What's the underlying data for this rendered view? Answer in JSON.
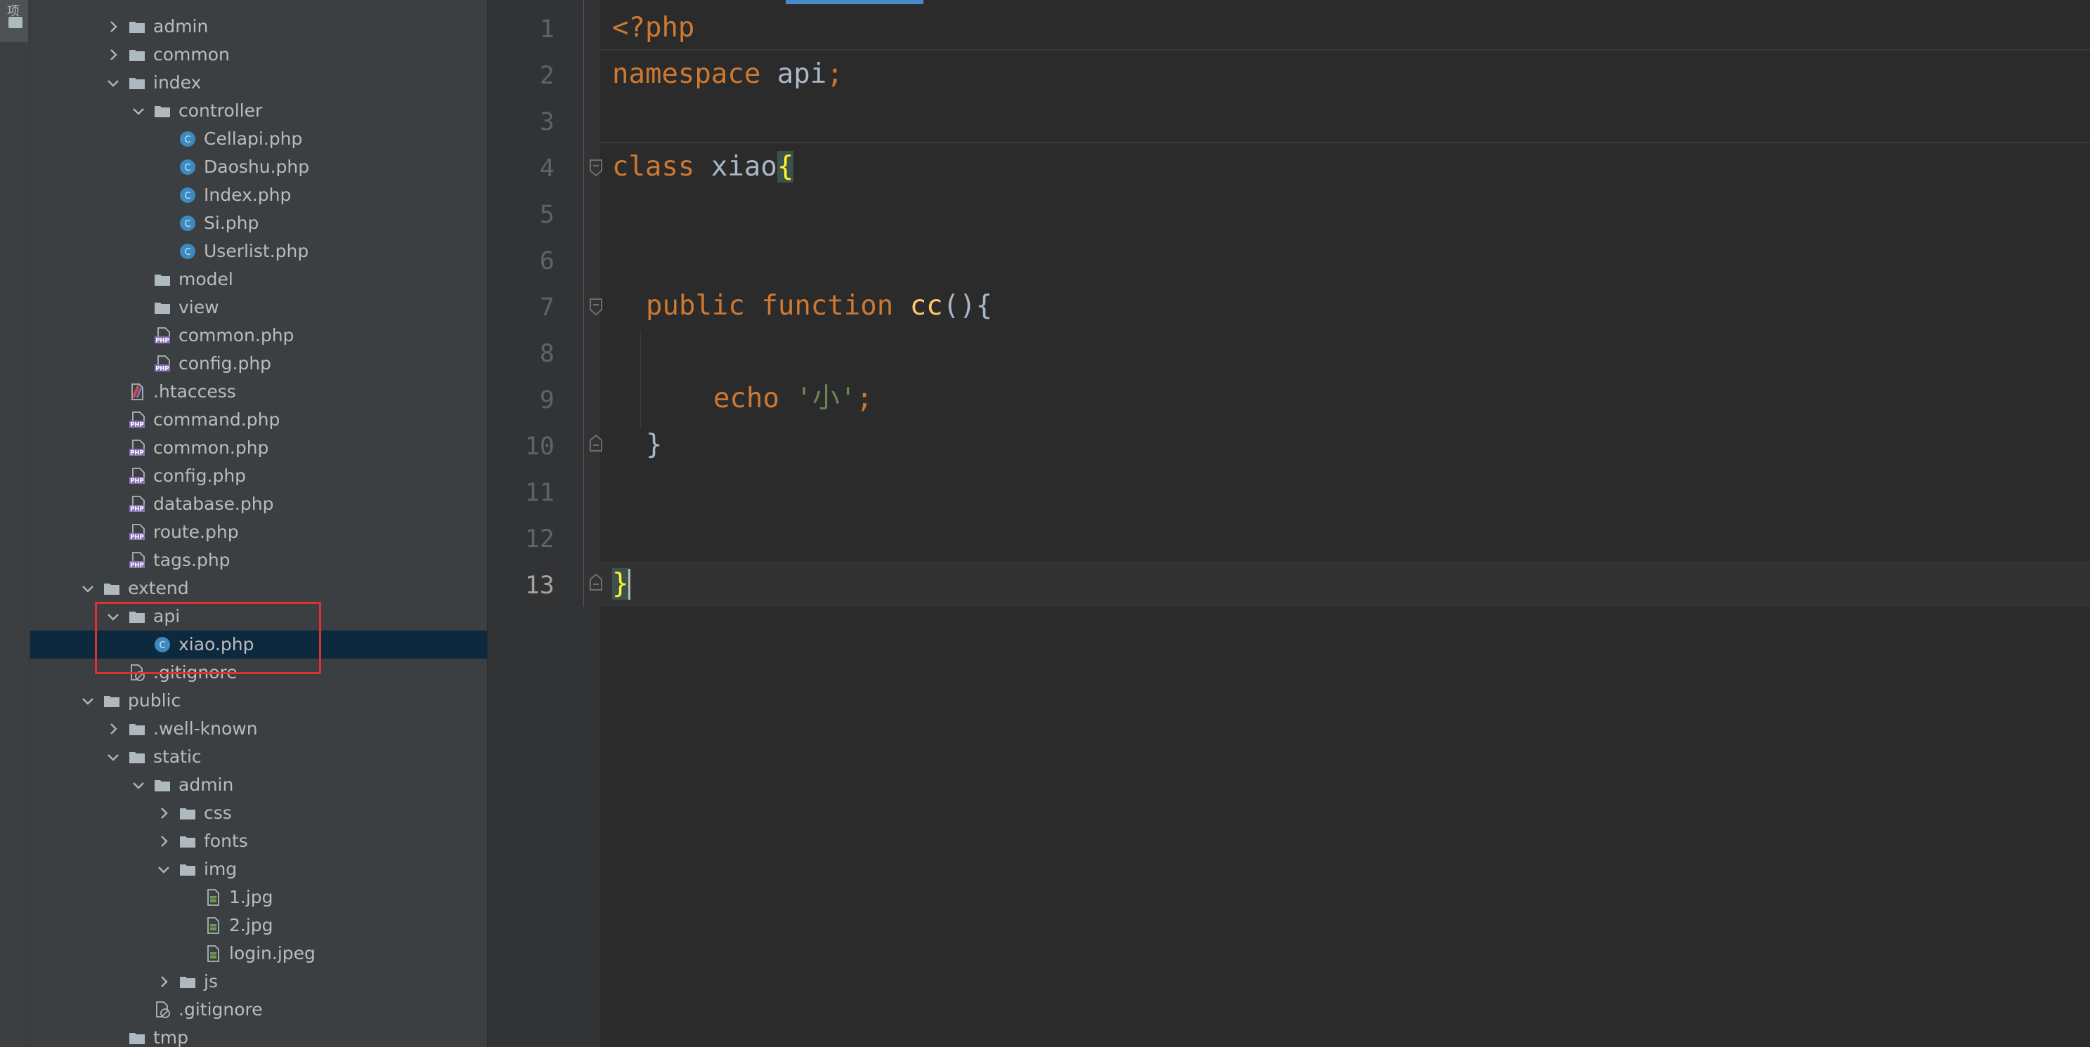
{
  "stripe": {
    "label": "项"
  },
  "tree": [
    {
      "label": "admin",
      "depth": 2,
      "icon": "folder",
      "expander": "collapsed"
    },
    {
      "label": "common",
      "depth": 2,
      "icon": "folder",
      "expander": "collapsed"
    },
    {
      "label": "index",
      "depth": 2,
      "icon": "folder",
      "expander": "expanded"
    },
    {
      "label": "controller",
      "depth": 3,
      "icon": "folder",
      "expander": "expanded"
    },
    {
      "label": "Cellapi.php",
      "depth": 4,
      "icon": "class-c",
      "expander": "none"
    },
    {
      "label": "Daoshu.php",
      "depth": 4,
      "icon": "class-c",
      "expander": "none"
    },
    {
      "label": "Index.php",
      "depth": 4,
      "icon": "class-c",
      "expander": "none"
    },
    {
      "label": "Si.php",
      "depth": 4,
      "icon": "class-c",
      "expander": "none"
    },
    {
      "label": "Userlist.php",
      "depth": 4,
      "icon": "class-c",
      "expander": "none"
    },
    {
      "label": "model",
      "depth": 3,
      "icon": "folder",
      "expander": "none"
    },
    {
      "label": "view",
      "depth": 3,
      "icon": "folder",
      "expander": "none"
    },
    {
      "label": "common.php",
      "depth": 3,
      "icon": "php-file",
      "expander": "none"
    },
    {
      "label": "config.php",
      "depth": 3,
      "icon": "php-file",
      "expander": "none"
    },
    {
      "label": ".htaccess",
      "depth": 2,
      "icon": "htaccess",
      "expander": "none"
    },
    {
      "label": "command.php",
      "depth": 2,
      "icon": "php-file",
      "expander": "none"
    },
    {
      "label": "common.php",
      "depth": 2,
      "icon": "php-file",
      "expander": "none"
    },
    {
      "label": "config.php",
      "depth": 2,
      "icon": "php-file",
      "expander": "none"
    },
    {
      "label": "database.php",
      "depth": 2,
      "icon": "php-file",
      "expander": "none"
    },
    {
      "label": "route.php",
      "depth": 2,
      "icon": "php-file",
      "expander": "none"
    },
    {
      "label": "tags.php",
      "depth": 2,
      "icon": "php-file",
      "expander": "none"
    },
    {
      "label": "extend",
      "depth": 1,
      "icon": "folder",
      "expander": "expanded"
    },
    {
      "label": "api",
      "depth": 2,
      "icon": "folder",
      "expander": "expanded"
    },
    {
      "label": "xiao.php",
      "depth": 3,
      "icon": "class-c",
      "expander": "none",
      "selected": true
    },
    {
      "label": ".gitignore",
      "depth": 2,
      "icon": "gitignore",
      "expander": "none"
    },
    {
      "label": "public",
      "depth": 1,
      "icon": "folder",
      "expander": "expanded"
    },
    {
      "label": ".well-known",
      "depth": 2,
      "icon": "folder",
      "expander": "collapsed"
    },
    {
      "label": "static",
      "depth": 2,
      "icon": "folder",
      "expander": "expanded"
    },
    {
      "label": "admin",
      "depth": 3,
      "icon": "folder",
      "expander": "expanded"
    },
    {
      "label": "css",
      "depth": 4,
      "icon": "folder",
      "expander": "collapsed"
    },
    {
      "label": "fonts",
      "depth": 4,
      "icon": "folder",
      "expander": "collapsed"
    },
    {
      "label": "img",
      "depth": 4,
      "icon": "folder",
      "expander": "expanded"
    },
    {
      "label": "1.jpg",
      "depth": 5,
      "icon": "image-file",
      "expander": "none"
    },
    {
      "label": "2.jpg",
      "depth": 5,
      "icon": "image-file",
      "expander": "none"
    },
    {
      "label": "login.jpeg",
      "depth": 5,
      "icon": "image-file",
      "expander": "none"
    },
    {
      "label": "js",
      "depth": 4,
      "icon": "folder",
      "expander": "collapsed"
    },
    {
      "label": ".gitignore",
      "depth": 3,
      "icon": "gitignore",
      "expander": "none"
    },
    {
      "label": "tmp",
      "depth": 2,
      "icon": "folder",
      "expander": "none"
    }
  ],
  "editor": {
    "line_numbers": [
      "1",
      "2",
      "3",
      "4",
      "5",
      "6",
      "7",
      "8",
      "9",
      "10",
      "11",
      "12",
      "13"
    ],
    "current_line": "13",
    "code": {
      "l1_open": "<?php",
      "l2_namespace": "namespace",
      "l2_name": " api",
      "l2_semi": ";",
      "l4_class": "class",
      "l4_name": " xiao",
      "l4_brace": "{",
      "l7_public": "public",
      "l7_function": " function",
      "l7_name": " cc",
      "l7_rest": "(){",
      "l9_echo": "echo",
      "l9_string": " '小'",
      "l9_semi": ";",
      "l10_close": "}",
      "l13_close": "}"
    }
  },
  "colors": {
    "keyword": "#cc7832",
    "function": "#ffc66d",
    "string": "#6a8759",
    "selection": "#0d293e",
    "highlight_box": "#e03131"
  }
}
